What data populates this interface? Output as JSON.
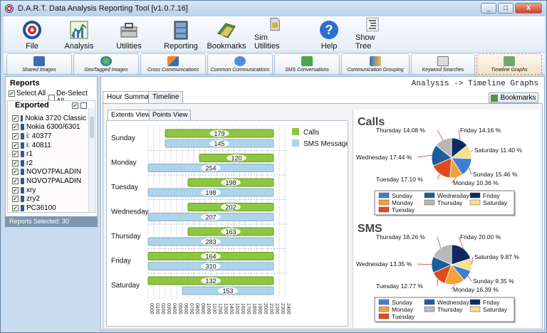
{
  "window": {
    "title": "D.A.R.T. Data Analysis Reporting Tool [v1.0.7.16]",
    "min": "_",
    "max": "□",
    "close": "X"
  },
  "toolbar": {
    "items": [
      "File",
      "Analysis",
      "Utilities",
      "Reporting",
      "Bookmarks",
      "Sim Utilities",
      "Help",
      "Show Tree"
    ]
  },
  "subtabs": [
    "Shared Images",
    "GeoTagged Images",
    "Cross Communications",
    "Common Communications",
    "SMS Conversations",
    "Communication Grouping",
    "Keyword Searches",
    "Timeline Graphs"
  ],
  "sidebar": {
    "heading": "Reports",
    "select_all": "Select All",
    "deselect_all": "De-Select All",
    "exported": "Exported",
    "items": [
      "Nokia 3720 Classic",
      "Nokia 6300/6301",
      "i: 40377",
      "i: 40811",
      "r1",
      "r2",
      "NOVO7PALADIN",
      "NOVO7PALADIN",
      "xry",
      "zry2",
      "PC36100"
    ],
    "status": "Reports Selected: 30"
  },
  "main": {
    "breadcrumb": "Analysis -> Timeline Graphs",
    "bookmarks": "Bookmarks",
    "tabs": [
      "Hour Summary",
      "Timeline"
    ],
    "subtabs": [
      "Extents View",
      "Points View"
    ]
  },
  "chart_data": [
    {
      "type": "bar",
      "categories": [
        "Sunday",
        "Monday",
        "Tuesday",
        "Wednesday",
        "Thursday",
        "Friday",
        "Saturday"
      ],
      "series": [
        {
          "name": "Calls",
          "values": [
            179,
            120,
            198,
            202,
            163,
            164,
            132
          ],
          "color": "#8dc63f"
        },
        {
          "name": "SMS Messages",
          "values": [
            145,
            254,
            198,
            207,
            283,
            310,
            153
          ],
          "color": "#aed3ea"
        }
      ],
      "ranges": {
        "Calls": [
          [
            300,
            2200
          ],
          [
            900,
            2200
          ],
          [
            700,
            2200
          ],
          [
            700,
            2200
          ],
          [
            700,
            2200
          ],
          [
            0,
            2200
          ],
          [
            0,
            2200
          ]
        ],
        "SMS Messages": [
          [
            300,
            2200
          ],
          [
            0,
            2200
          ],
          [
            0,
            2200
          ],
          [
            0,
            2200
          ],
          [
            0,
            2200
          ],
          [
            0,
            2200
          ],
          [
            600,
            2200
          ]
        ]
      },
      "x_ticks": [
        "0000",
        "0100",
        "0200",
        "0300",
        "0400",
        "0500",
        "0600",
        "0700",
        "0800",
        "0900",
        "1000",
        "1100",
        "1200",
        "1300",
        "1400",
        "1500",
        "1600",
        "1700",
        "1800",
        "1900",
        "2000",
        "2100",
        "2200",
        "2300",
        "2400"
      ],
      "xlim": [
        0,
        2400
      ]
    },
    {
      "type": "pie",
      "title": "Calls",
      "labels": [
        "Sunday",
        "Monday",
        "Tuesday",
        "Wednesday",
        "Thursday",
        "Friday",
        "Saturday"
      ],
      "values": [
        15.46,
        10.36,
        17.1,
        17.44,
        14.08,
        14.16,
        11.4
      ],
      "display": [
        "Sunday 15.46 %",
        "Monday 10.36 %",
        "Tuesday 17.10 %",
        "Wednesday 17.44 %",
        "Thursday 14.08 %",
        "Friday 14.16 %",
        "Saturday 11.40 %"
      ]
    },
    {
      "type": "pie",
      "title": "SMS",
      "labels": [
        "Sunday",
        "Monday",
        "Tuesday",
        "Wednesday",
        "Thursday",
        "Friday",
        "Saturday"
      ],
      "values": [
        9.35,
        16.39,
        12.77,
        13.35,
        18.26,
        20.0,
        9.87
      ],
      "display": [
        "Sunday 9.35 %",
        "Monday 16.39 %",
        "Tuesday 12.77 %",
        "Wednesday 13.35 %",
        "Thursday 18.26 %",
        "Friday 20.00 %",
        "Saturday 9.87 %"
      ]
    }
  ],
  "day_colors": {
    "Sunday": "#3d7fd1",
    "Monday": "#f2a23c",
    "Tuesday": "#e04a1e",
    "Wednesday": "#1c5e9c",
    "Thursday": "#b8b8b8",
    "Friday": "#0f2a63",
    "Saturday": "#f7e08a"
  }
}
